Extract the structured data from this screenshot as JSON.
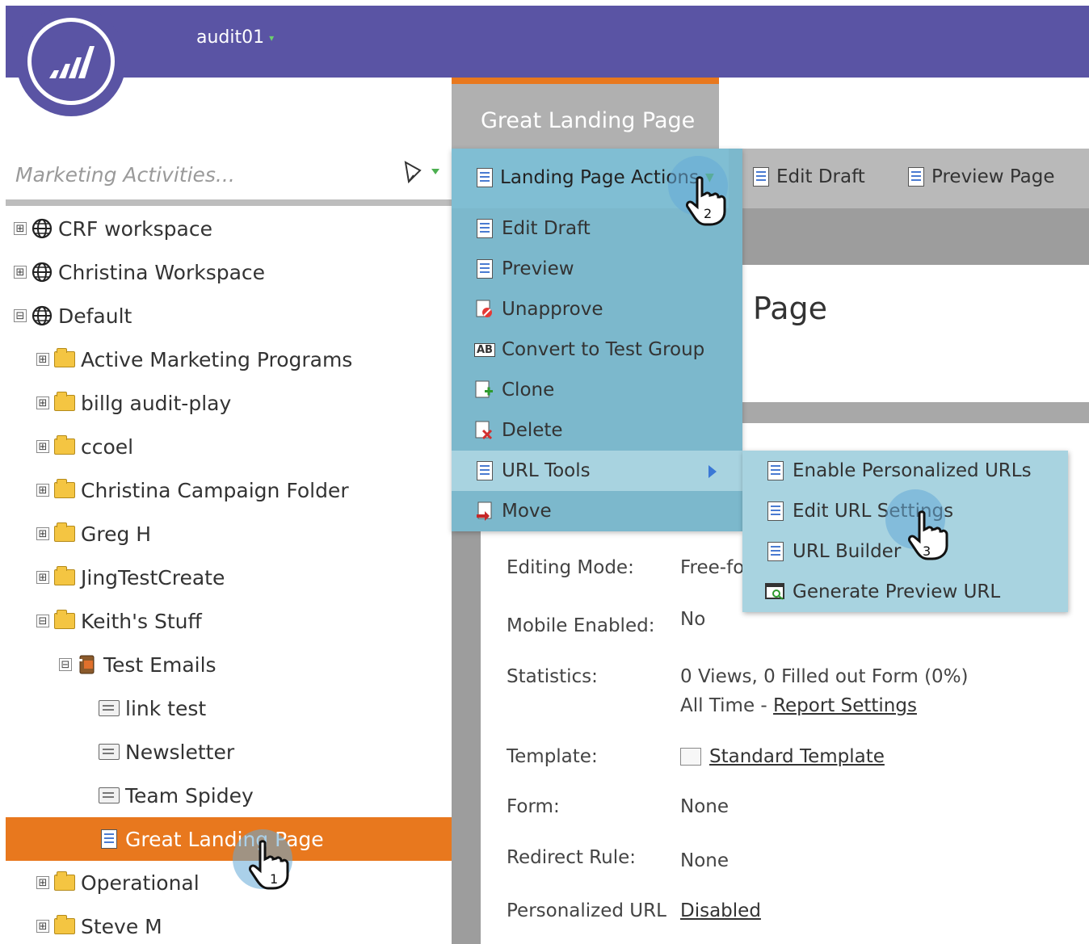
{
  "app": {
    "workspace_name": "audit01",
    "workspace_caret": "▾"
  },
  "search": {
    "placeholder": "Marketing Activities..."
  },
  "tree": {
    "items": [
      {
        "label": "CRF workspace",
        "toggle": "⊞",
        "icon": "globe-icon"
      },
      {
        "label": "Christina Workspace",
        "toggle": "⊞",
        "icon": "globe-icon"
      },
      {
        "label": "Default",
        "toggle": "⊟",
        "icon": "globe-icon"
      },
      {
        "label": "Active Marketing Programs",
        "toggle": "⊞",
        "icon": "folder-icon"
      },
      {
        "label": "billg audit-play",
        "toggle": "⊞",
        "icon": "folder-icon"
      },
      {
        "label": "ccoel",
        "toggle": "⊞",
        "icon": "folder-icon"
      },
      {
        "label": "Christina Campaign Folder",
        "toggle": "⊞",
        "icon": "folder-icon"
      },
      {
        "label": "Greg H",
        "toggle": "⊞",
        "icon": "folder-icon"
      },
      {
        "label": "JingTestCreate",
        "toggle": "⊞",
        "icon": "folder-icon"
      },
      {
        "label": "Keith's Stuff",
        "toggle": "⊟",
        "icon": "folder-icon"
      },
      {
        "label": "Test Emails",
        "toggle": "⊟",
        "icon": "program-icon"
      },
      {
        "label": "link test",
        "toggle": "",
        "icon": "email-approved-icon"
      },
      {
        "label": "Newsletter",
        "toggle": "",
        "icon": "email-icon"
      },
      {
        "label": "Team Spidey",
        "toggle": "",
        "icon": "email-icon"
      },
      {
        "label": "Great Landing Page",
        "toggle": "",
        "icon": "landing-page-icon"
      },
      {
        "label": "Operational",
        "toggle": "⊞",
        "icon": "folder-icon"
      },
      {
        "label": "Steve M",
        "toggle": "⊞",
        "icon": "folder-icon"
      }
    ]
  },
  "tab": {
    "title": "Great Landing Page"
  },
  "toolbar": {
    "actions_label": "Landing Page Actions",
    "edit_draft_label": "Edit Draft",
    "preview_page_label": "Preview Page"
  },
  "page": {
    "heading_partial": "Page"
  },
  "menu": {
    "items": [
      {
        "label": "Edit Draft",
        "icon": "edit-draft-icon"
      },
      {
        "label": "Preview",
        "icon": "preview-icon"
      },
      {
        "label": "Unapprove",
        "icon": "unapprove-icon"
      },
      {
        "label": "Convert to Test Group",
        "icon": "ab-test-icon"
      },
      {
        "label": "Clone",
        "icon": "clone-icon"
      },
      {
        "label": "Delete",
        "icon": "delete-icon"
      },
      {
        "label": "URL Tools",
        "icon": "url-tools-icon"
      },
      {
        "label": "Move",
        "icon": "move-icon"
      }
    ]
  },
  "submenu": {
    "items": [
      {
        "label": "Enable Personalized URLs",
        "icon": "personalized-url-icon"
      },
      {
        "label": "Edit URL Settings",
        "icon": "edit-url-icon"
      },
      {
        "label": "URL Builder",
        "icon": "url-builder-icon"
      },
      {
        "label": "Generate Preview URL",
        "icon": "preview-url-icon"
      }
    ]
  },
  "details": {
    "editing_mode_label": "Editing Mode:",
    "editing_mode_value": "Free-fo",
    "mobile_label": "Mobile Enabled:",
    "mobile_value": "No",
    "statistics_label": "Statistics:",
    "statistics_value": "0 Views, 0 Filled out Form (0%)",
    "statistics_period": "All Time - ",
    "report_settings_link": "Report Settings",
    "template_label": "Template:",
    "template_link": "Standard Template",
    "form_label": "Form:",
    "form_value": "None",
    "redirect_label": "Redirect Rule:",
    "redirect_value": "None",
    "purl_label": "Personalized URL",
    "purl_link": "Disabled"
  },
  "callouts": [
    "1",
    "2",
    "3"
  ],
  "colors": {
    "header": "#5a54a4",
    "selected": "#e8781e",
    "menu": "#7cb8cc",
    "submenu": "#a8d3e0"
  }
}
